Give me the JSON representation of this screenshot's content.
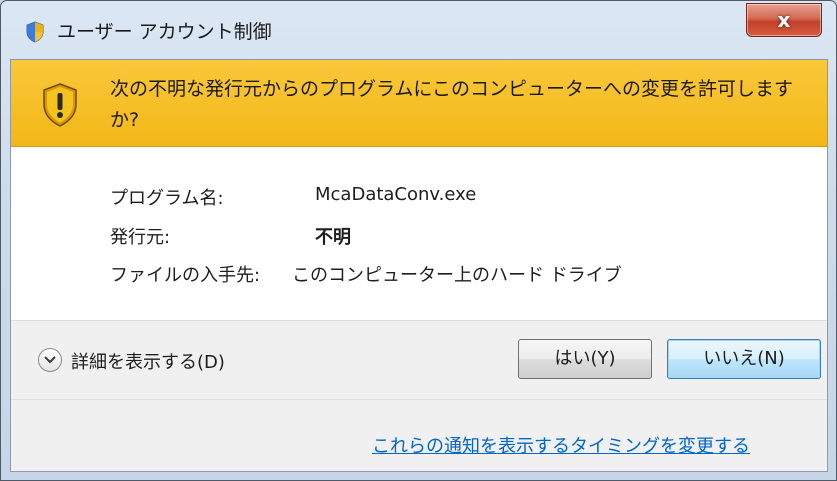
{
  "window": {
    "title": "ユーザー アカウント制御",
    "close_label": "x"
  },
  "banner": {
    "message": "次の不明な発行元からのプログラムにこのコンピューターへの変更を許可しますか?"
  },
  "details": {
    "program_name_label": "プログラム名:",
    "program_name_value": "McaDataConv.exe",
    "publisher_label": "発行元:",
    "publisher_value": "不明",
    "file_origin_label": "ファイルの入手先:",
    "file_origin_value": "このコンピューター上のハード ドライブ"
  },
  "footer": {
    "show_details_label": "詳細を表示する(D)",
    "yes_button": "はい(Y)",
    "no_button": "いいえ(N)",
    "change_notification_link": "これらの通知を表示するタイミングを変更する"
  },
  "colors": {
    "banner": "#f3b717",
    "link": "#0066cc",
    "close_button": "#c2412b"
  },
  "icons": [
    "uac-shield-icon",
    "warning-shield-icon",
    "chevron-down-icon"
  ]
}
